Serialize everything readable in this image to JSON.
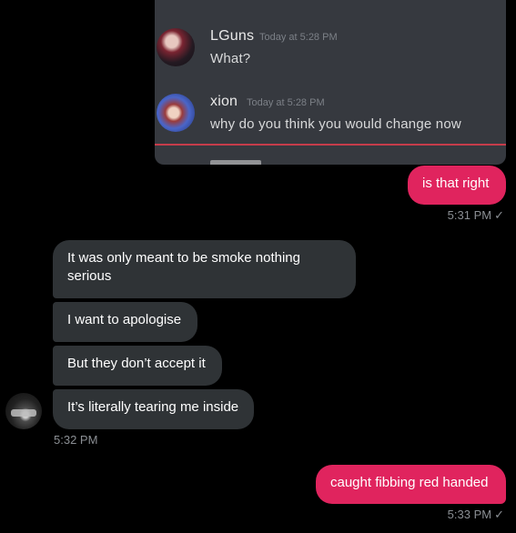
{
  "screenshot": {
    "messages": [
      {
        "name": "LGuns",
        "time": "Today at 5:28 PM",
        "text": "What?"
      },
      {
        "name": "xion",
        "time": "Today at 5:28 PM",
        "text": "why do you think you would change now"
      }
    ]
  },
  "conversation": {
    "out1": {
      "text": "is that right",
      "time": "5:31 PM"
    },
    "incoming": [
      {
        "text": "It was only meant to be smoke nothing serious"
      },
      {
        "text": "I want to apologise"
      },
      {
        "text": "But they don’t accept it"
      },
      {
        "text": "It’s literally tearing me inside"
      }
    ],
    "incoming_time": "5:32 PM",
    "out2": {
      "text": "caught fibbing red handed",
      "time": "5:33 PM"
    },
    "check_glyph": "✓"
  }
}
